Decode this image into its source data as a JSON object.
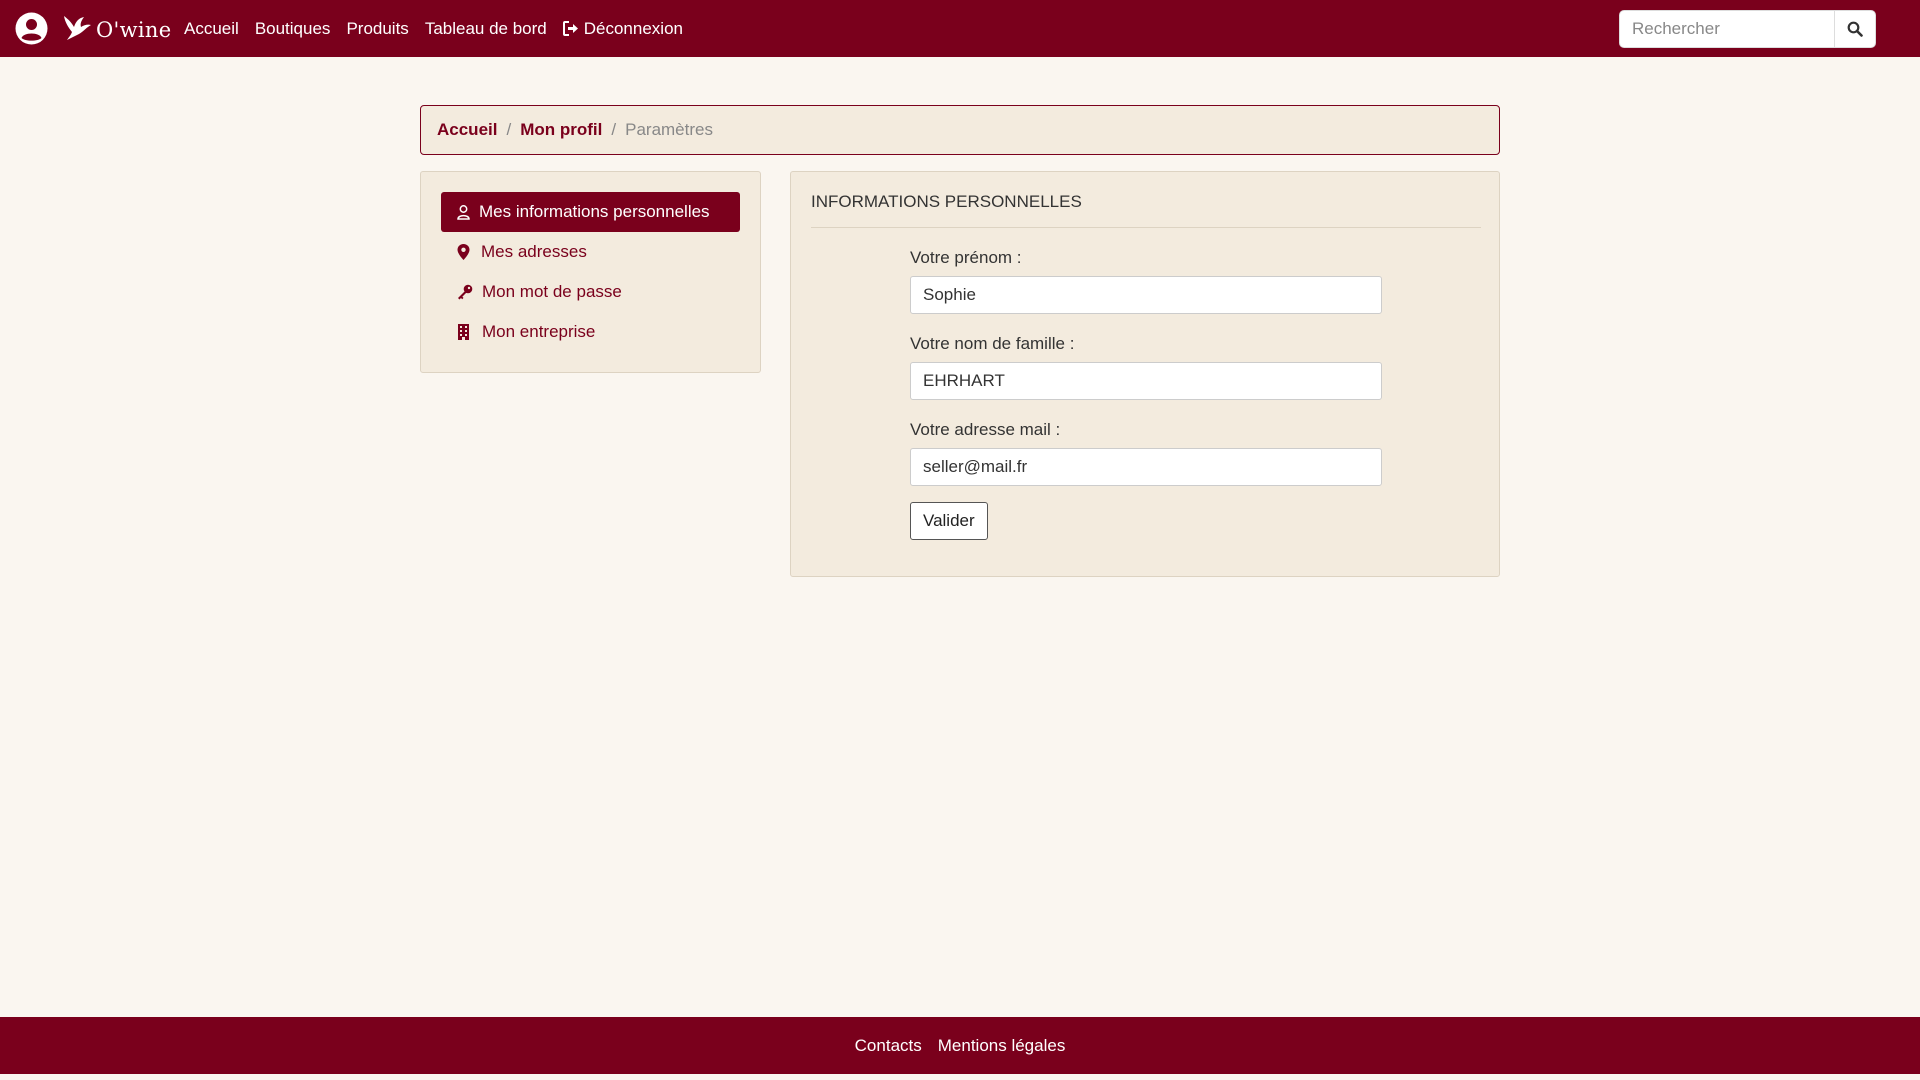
{
  "colors": {
    "brand": "#7a001c",
    "page_bg": "#faf6f0",
    "panel_bg": "#f3ebde"
  },
  "navbar": {
    "user_icon": "user-circle-icon",
    "brand_logo": "bird-logo-icon",
    "brand_name": "O'wine",
    "links": [
      "Accueil",
      "Boutiques",
      "Produits",
      "Tableau de bord"
    ],
    "logout_label": "Déconnexion",
    "logout_icon": "sign-out-icon",
    "search_placeholder": "Rechercher",
    "search_icon": "search-icon"
  },
  "breadcrumb": {
    "items": [
      "Accueil",
      "Mon profil"
    ],
    "current": "Paramètres"
  },
  "sidebar": {
    "items": [
      {
        "label": "Mes informations personnelles",
        "icon": "user-icon",
        "active": true
      },
      {
        "label": "Mes adresses",
        "icon": "map-marker-icon",
        "active": false
      },
      {
        "label": "Mon mot de passe",
        "icon": "key-icon",
        "active": false
      },
      {
        "label": "Mon entreprise",
        "icon": "building-icon",
        "active": false
      }
    ]
  },
  "form": {
    "title": "INFORMATIONS PERSONNELLES",
    "fields": [
      {
        "label": "Votre prénom :",
        "value": "Sophie"
      },
      {
        "label": "Votre nom de famille :",
        "value": "EHRHART"
      },
      {
        "label": "Votre adresse mail :",
        "value": "seller@mail.fr"
      }
    ],
    "submit_label": "Valider"
  },
  "footer": {
    "links": [
      "Contacts",
      "Mentions légales"
    ]
  }
}
